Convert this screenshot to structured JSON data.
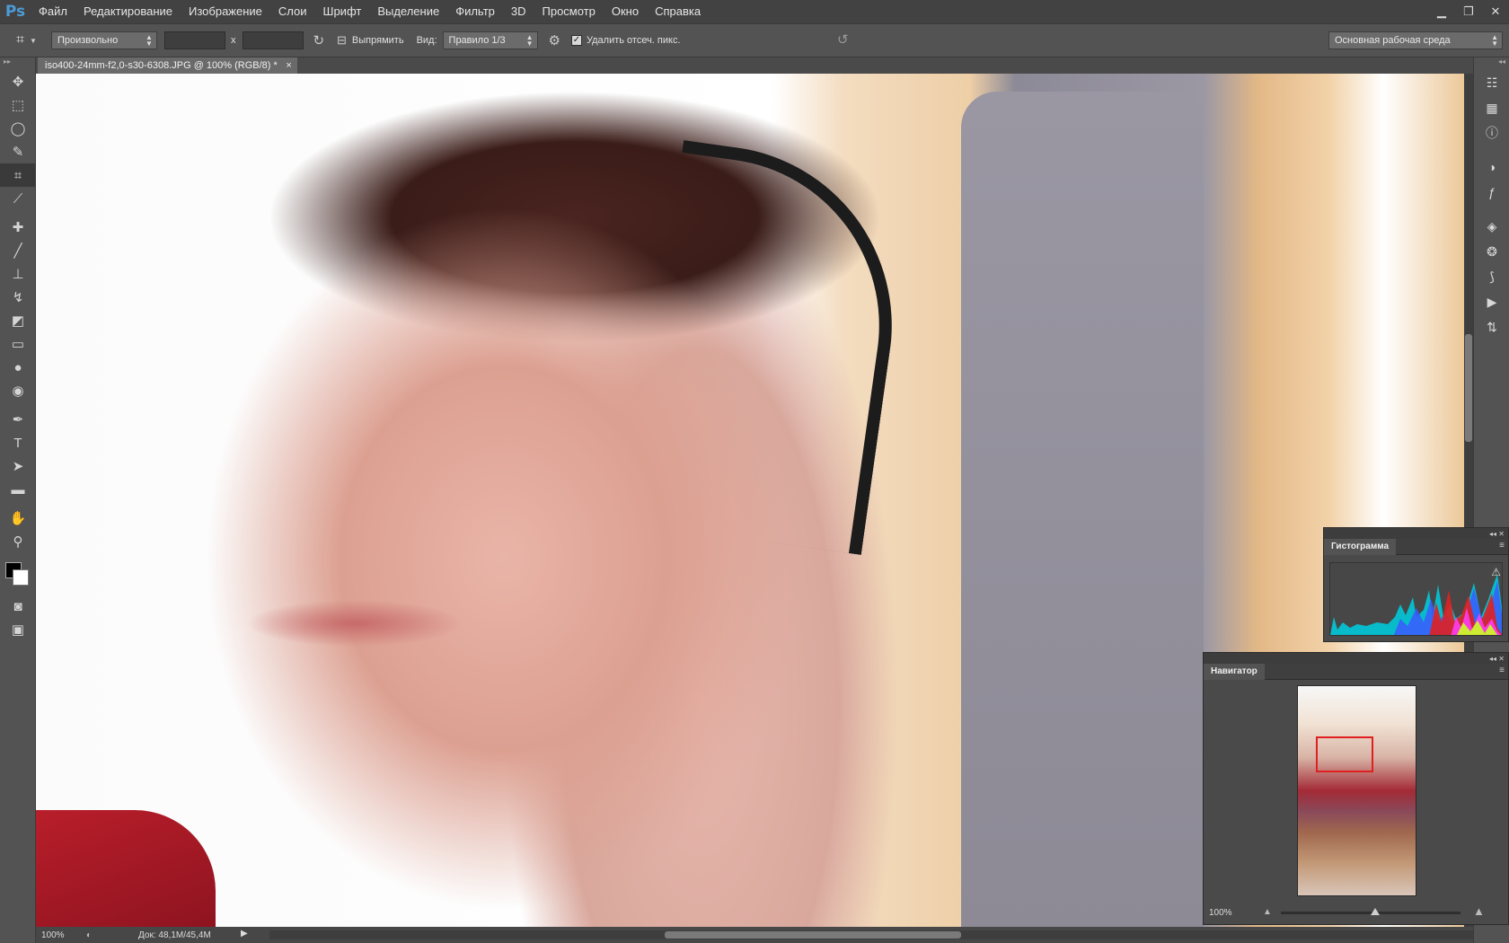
{
  "app": {
    "logo": "Ps",
    "menu": [
      "Файл",
      "Редактирование",
      "Изображение",
      "Слои",
      "Шрифт",
      "Выделение",
      "Фильтр",
      "3D",
      "Просмотр",
      "Окно",
      "Справка"
    ]
  },
  "window_controls": {
    "minimize": "▁",
    "restore": "❐",
    "close": "✕"
  },
  "options": {
    "tool_icon": "crop-icon",
    "ratio_select": "Произвольно",
    "width_value": "",
    "times_sign": "x",
    "height_value": "",
    "straighten_label": "Выпрямить",
    "view_label": "Вид:",
    "view_select": "Правило 1/3",
    "delete_cropped_label": "Удалить отсеч. пикс.",
    "delete_cropped_checked": true,
    "workspace_select": "Основная рабочая среда"
  },
  "document": {
    "tab_title": "iso400-24mm-f2,0-s30-6308.JPG @ 100% (RGB/8) *",
    "close_glyph": "×"
  },
  "status": {
    "zoom": "100%",
    "doc_info": "Док: 48,1M/45,4M"
  },
  "panels": {
    "histogram": {
      "title": "Гистограмма",
      "warning": "⚠"
    },
    "navigator": {
      "title": "Навигатор",
      "zoom": "100%"
    }
  },
  "tools": [
    "move-icon",
    "marquee-icon",
    "lasso-icon",
    "quick-select-icon",
    "crop-icon",
    "eyedropper-icon",
    "healing-icon",
    "brush-icon",
    "stamp-icon",
    "history-brush-icon",
    "eraser-icon",
    "gradient-icon",
    "blur-icon",
    "dodge-icon",
    "pen-icon",
    "type-icon",
    "path-select-icon",
    "rectangle-icon",
    "hand-icon",
    "zoom-icon"
  ],
  "dock_icons": [
    "3d-icon",
    "swatches-icon",
    "info-icon",
    "adjustments-icon",
    "styles-icon",
    "layers-icon",
    "channels-icon",
    "paths-icon",
    "actions-icon",
    "history-icon"
  ]
}
